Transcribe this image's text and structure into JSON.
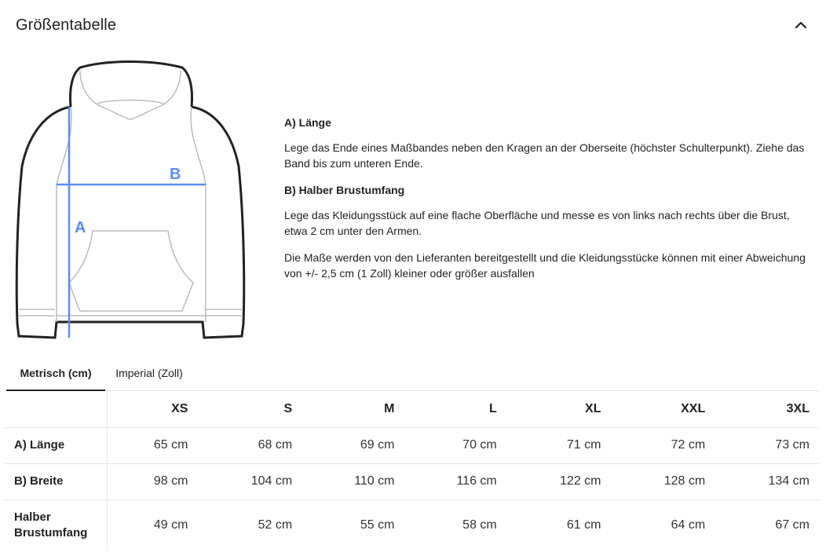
{
  "header": {
    "title": "Größentabelle",
    "collapse_icon": "chevron-up-icon"
  },
  "illustration": {
    "label_a": "A",
    "label_b": "B",
    "measure_color": "#5b8def"
  },
  "description": {
    "a_heading": "A) Länge",
    "a_text": "Lege das Ende eines Maßbandes neben den Kragen an der Oberseite (höchster Schulterpunkt). Ziehe das Band bis zum unteren Ende.",
    "b_heading": "B) Halber Brustumfang",
    "b_text": "Lege das Kleidungsstück auf eine flache Oberfläche und messe es von links nach rechts über die Brust, etwa 2 cm unter den Armen.",
    "note": "Die Maße werden von den Lieferanten bereitgestellt und die Kleidungsstücke können mit einer Abweichung von +/- 2,5 cm (1 Zoll) kleiner oder größer ausfallen"
  },
  "tabs": [
    {
      "label": "Metrisch (cm)",
      "active": true
    },
    {
      "label": "Imperial (Zoll)",
      "active": false
    }
  ],
  "table": {
    "columns": [
      "XS",
      "S",
      "M",
      "L",
      "XL",
      "XXL",
      "3XL"
    ],
    "rows": [
      {
        "label": "A) Länge",
        "values": [
          "65 cm",
          "68 cm",
          "69 cm",
          "70 cm",
          "71 cm",
          "72 cm",
          "73 cm"
        ]
      },
      {
        "label": "B) Breite",
        "values": [
          "98 cm",
          "104 cm",
          "110 cm",
          "116 cm",
          "122 cm",
          "128 cm",
          "134 cm"
        ]
      },
      {
        "label": "Halber Brustumfang",
        "values": [
          "49 cm",
          "52 cm",
          "55 cm",
          "58 cm",
          "61 cm",
          "64 cm",
          "67 cm"
        ]
      }
    ]
  }
}
